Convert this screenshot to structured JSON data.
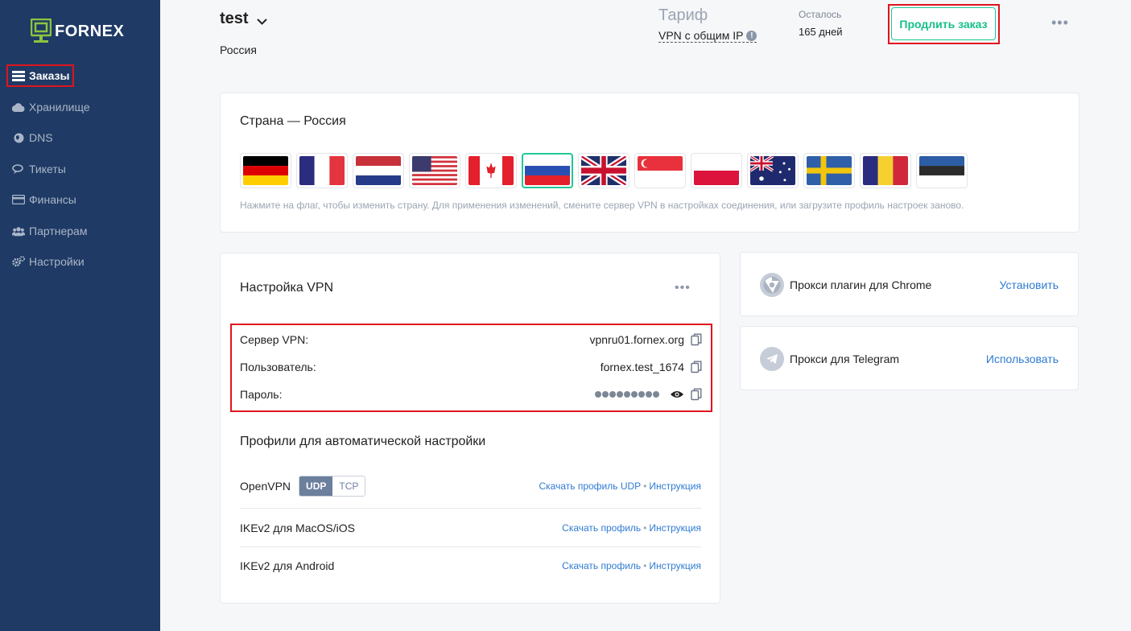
{
  "brand": {
    "name": "FORNEX",
    "accent": "#20c997",
    "sidebar_bg": "#1f3a64"
  },
  "sidebar": {
    "items": [
      {
        "label": "Заказы",
        "icon": "server-icon",
        "active": true
      },
      {
        "label": "Хранилище",
        "icon": "cloud-icon",
        "active": false
      },
      {
        "label": "DNS",
        "icon": "globe-icon",
        "active": false
      },
      {
        "label": "Тикеты",
        "icon": "chat-icon",
        "active": false
      },
      {
        "label": "Финансы",
        "icon": "credit-card-icon",
        "active": false
      },
      {
        "label": "Партнерам",
        "icon": "users-icon",
        "active": false
      },
      {
        "label": "Настройки",
        "icon": "gears-icon",
        "active": false
      }
    ]
  },
  "header": {
    "order_name": "test",
    "country": "Россия",
    "tariff_label": "Тариф",
    "tariff_value": "VPN с общим IP",
    "remain_label": "Осталось",
    "remain_value": "165 дней",
    "renew_button": "Продлить заказ",
    "more": "•••"
  },
  "country_card": {
    "title": "Страна — Россия",
    "flags": [
      {
        "country": "Germany",
        "selected": false
      },
      {
        "country": "France",
        "selected": false
      },
      {
        "country": "Netherlands",
        "selected": false
      },
      {
        "country": "USA",
        "selected": false
      },
      {
        "country": "Canada",
        "selected": false
      },
      {
        "country": "Russia",
        "selected": true
      },
      {
        "country": "United Kingdom",
        "selected": false
      },
      {
        "country": "Singapore",
        "selected": false
      },
      {
        "country": "Poland",
        "selected": false
      },
      {
        "country": "Australia",
        "selected": false
      },
      {
        "country": "Sweden",
        "selected": false
      },
      {
        "country": "Romania",
        "selected": false
      },
      {
        "country": "Estonia",
        "selected": false
      }
    ],
    "hint": "Нажмите на флаг, чтобы изменить страну. Для применения изменений, смените сервер VPN в настройках соединения, или загрузите профиль настроек заново."
  },
  "vpn_card": {
    "title": "Настройка VPN",
    "more": "•••",
    "server_label": "Сервер VPN:",
    "server_value": "vpnru01.fornex.org",
    "user_label": "Пользователь:",
    "user_value": "fornex.test_1674",
    "password_label": "Пароль:",
    "password_dots": 9,
    "profiles_title": "Профили для автоматической настройки",
    "profiles": [
      {
        "name": "OpenVPN",
        "toggle": [
          "UDP",
          "TCP"
        ],
        "toggle_selected": "UDP",
        "link": "Скачать профиль UDP",
        "instruction": "Инструкция"
      },
      {
        "name": "IKEv2 для MacOS/iOS",
        "link": "Скачать профиль",
        "instruction": "Инструкция"
      },
      {
        "name": "IKEv2 для Android",
        "link": "Скачать профиль",
        "instruction": "Инструкция"
      }
    ],
    "bullet": "•"
  },
  "side_cards": [
    {
      "label": "Прокси плагин для Chrome",
      "action": "Установить",
      "icon": "chrome-icon"
    },
    {
      "label": "Прокси для Telegram",
      "action": "Использовать",
      "icon": "telegram-icon"
    }
  ]
}
